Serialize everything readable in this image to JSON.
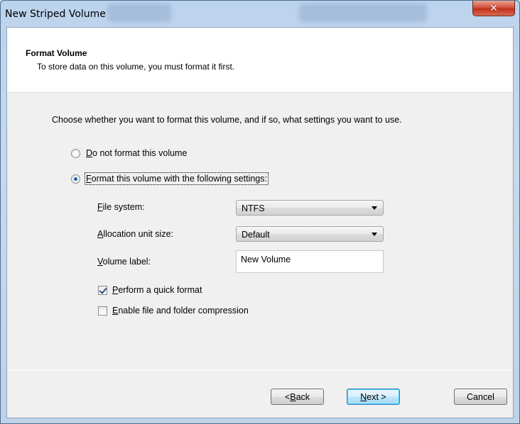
{
  "window": {
    "title": "New Striped Volume",
    "close_symbol": "✕"
  },
  "header": {
    "title": "Format Volume",
    "subtitle": "To store data on this volume, you must format it first."
  },
  "intro": "Choose whether you want to format this volume, and if so, what settings you want to use.",
  "options": {
    "no_format_prefix": "D",
    "no_format_rest": "o not format this volume",
    "format_prefix": "F",
    "format_rest": "ormat this volume with the following settings:",
    "selected": "format"
  },
  "fields": {
    "file_system_label_u": "F",
    "file_system_label_rest": "ile system:",
    "file_system_value": "NTFS",
    "alloc_label_u": "A",
    "alloc_label_rest": "llocation unit size:",
    "alloc_value": "Default",
    "volume_label_u": "V",
    "volume_label_rest": "olume label:",
    "volume_label_value": "New Volume"
  },
  "checkboxes": {
    "quick_u": "P",
    "quick_rest": "erform a quick format",
    "quick_checked": true,
    "compress_u": "E",
    "compress_rest": "nable file and folder compression",
    "compress_checked": false
  },
  "buttons": {
    "back_pre": "< ",
    "back_u": "B",
    "back_rest": "ack",
    "next_u": "N",
    "next_rest": "ext >",
    "cancel": "Cancel"
  }
}
